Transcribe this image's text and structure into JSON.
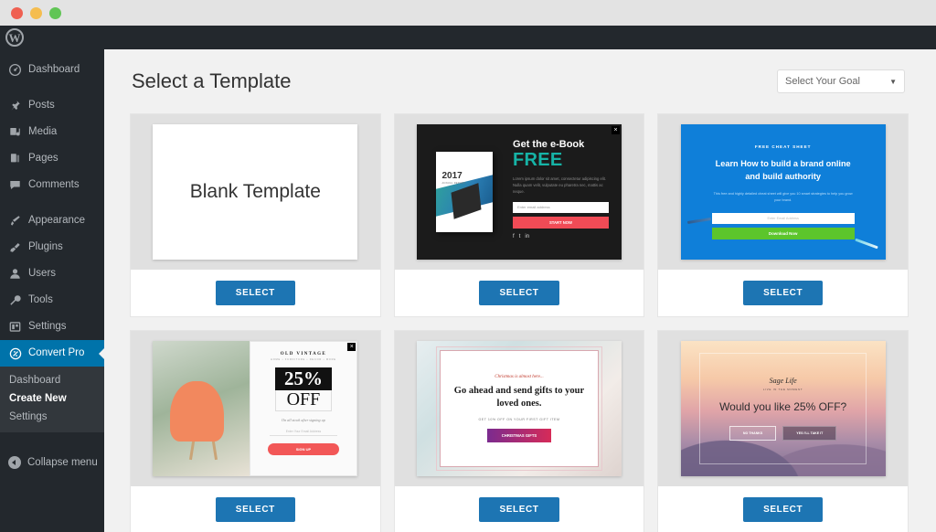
{
  "window": {
    "traffic_lights": [
      "close",
      "minimize",
      "maximize"
    ]
  },
  "admin_bar": {
    "logo": "wordpress-logo"
  },
  "sidebar": {
    "items": [
      {
        "label": "Dashboard",
        "icon": "dashboard-icon",
        "active": false
      },
      {
        "label": "Posts",
        "icon": "pin-icon",
        "active": false
      },
      {
        "label": "Media",
        "icon": "media-icon",
        "active": false
      },
      {
        "label": "Pages",
        "icon": "pages-icon",
        "active": false
      },
      {
        "label": "Comments",
        "icon": "comment-icon",
        "active": false
      },
      {
        "label": "Appearance",
        "icon": "brush-icon",
        "active": false
      },
      {
        "label": "Plugins",
        "icon": "plugin-icon",
        "active": false
      },
      {
        "label": "Users",
        "icon": "user-icon",
        "active": false
      },
      {
        "label": "Tools",
        "icon": "wrench-icon",
        "active": false
      },
      {
        "label": "Settings",
        "icon": "settings-icon",
        "active": false
      },
      {
        "label": "Convert Pro",
        "icon": "convert-pro-icon",
        "active": true
      }
    ],
    "submenu": [
      {
        "label": "Dashboard",
        "current": false
      },
      {
        "label": "Create New",
        "current": true
      },
      {
        "label": "Settings",
        "current": false
      }
    ],
    "collapse_label": "Collapse menu",
    "active_color": "#0073aa",
    "background": "#23282d"
  },
  "main": {
    "title": "Select a Template",
    "goal_dropdown": {
      "value": "Select Your Goal",
      "caret": "chevron-down-icon"
    },
    "select_button_label": "SELECT",
    "select_button_color": "#1d75b3",
    "templates": [
      {
        "id": "blank",
        "name": "Blank Template",
        "title": "Blank Template",
        "button": "SELECT"
      },
      {
        "id": "ebook",
        "name": "Get the e-Book FREE",
        "heading": "Get the e-Book",
        "highlight": "FREE",
        "body": "Lorem ipsum dolor sit amet, consectetur adipiscing elit. Nulla quam velit, vulputate eu pharetra nec, mattis ac neque.",
        "input_placeholder": "Enter email address",
        "cta": "START NOW",
        "book_year": "2017",
        "book_sub": "ANNUAL REPORT",
        "social": [
          "f",
          "t",
          "in"
        ],
        "close": "×",
        "accent": "#16b3a6",
        "cta_color": "#f04b56",
        "button": "SELECT"
      },
      {
        "id": "cheatsheet",
        "name": "Free Cheat Sheet",
        "eyebrow": "FREE CHEAT SHEET",
        "heading": "Learn How to build a brand online and build authority",
        "body": "This free and highly detailed cheat sheet will give you 10 smart strategies to help you grow your brand.",
        "input_placeholder": "Enter Email Address",
        "cta": "Download Now",
        "background": "#0f7fd9",
        "cta_color": "#5cc52c",
        "button": "SELECT"
      },
      {
        "id": "vintage",
        "name": "Old Vintage 25% Off",
        "logo": "OLD VINTAGE",
        "logo_sub": "HOME • FURNITURE • DECOR • MORE",
        "discount": "25%",
        "discount_label": "OFF",
        "note": "On all stock after signing up",
        "input_placeholder": "Enter Your Email Address",
        "cta": "SIGN UP",
        "close": "×",
        "cta_color": "#f25757",
        "button": "SELECT"
      },
      {
        "id": "christmas",
        "name": "Christmas Gifts",
        "eyebrow": "Christmas is almost here...",
        "heading": "Go ahead and send gifts to your loved ones.",
        "sub": "GET 10% OFF ON YOUR FIRST GIFT ITEM",
        "cta": "CHRISTMAS GIFTS",
        "button": "SELECT"
      },
      {
        "id": "sage",
        "name": "Sage Life 25% Off",
        "logo": "Sage Life",
        "logo_sub": "LIVE IN THE MOMENT",
        "heading": "Would you like 25% OFF?",
        "cta_primary": "NO THANKS",
        "cta_secondary": "YES I'LL TAKE IT",
        "button": "SELECT"
      }
    ]
  }
}
